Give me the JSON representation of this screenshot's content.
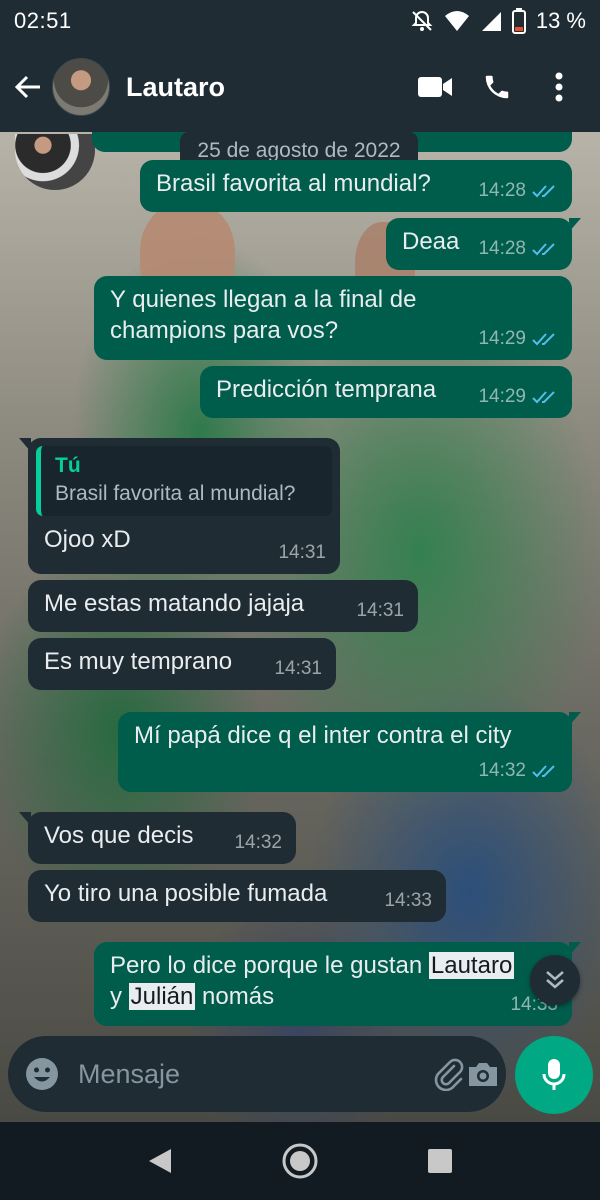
{
  "status_bar": {
    "time": "02:51",
    "battery": "13 %",
    "icons": [
      "notifications-off-icon",
      "wifi-icon",
      "signal-icon",
      "battery-low-icon"
    ]
  },
  "header": {
    "contact_name": "Lautaro",
    "icons": [
      "back-arrow-icon",
      "video-call-icon",
      "voice-call-icon",
      "more-vert-icon"
    ]
  },
  "chat": {
    "date_chip": "25 de agosto de 2022",
    "messages": [
      {
        "direction": "out",
        "text": "Brasil favorita al mundial?",
        "time": "14:28",
        "status": "read"
      },
      {
        "direction": "out",
        "text": "Deaa",
        "time": "14:28",
        "status": "read"
      },
      {
        "direction": "out",
        "text_lines": [
          "Y quienes llegan a la final de",
          "champions para vos?"
        ],
        "time": "14:29",
        "status": "read"
      },
      {
        "direction": "out",
        "text": "Predicción temprana",
        "time": "14:29",
        "status": "read"
      },
      {
        "direction": "in",
        "quote": {
          "author": "Tú",
          "text": "Brasil favorita al mundial?"
        },
        "text": "Ojoo xD",
        "time": "14:31"
      },
      {
        "direction": "in",
        "text": "Me estas matando jajaja",
        "time": "14:31"
      },
      {
        "direction": "in",
        "text": "Es muy temprano",
        "time": "14:31"
      },
      {
        "direction": "out",
        "text": "Mí papá dice q el inter contra el city",
        "time": "14:32",
        "status": "read"
      },
      {
        "direction": "in",
        "text": "Vos que decis",
        "time": "14:32"
      },
      {
        "direction": "in",
        "text": "Yo tiro una posible fumada",
        "time": "14:33"
      },
      {
        "direction": "out",
        "parts": [
          "Pero lo dice porque le gustan ",
          "Lautaro",
          "y ",
          "Julián",
          " nomás"
        ],
        "time": "14:33"
      }
    ]
  },
  "composer": {
    "placeholder": "Mensaje",
    "icons": [
      "emoji-icon",
      "attach-icon",
      "camera-icon",
      "mic-icon"
    ]
  },
  "nav_bar": {
    "icons": [
      "back-triangle-icon",
      "home-circle-icon",
      "recents-square-icon"
    ]
  },
  "colors": {
    "header_bg": "#1f2c34",
    "outgoing_bubble": "#005c4b",
    "incoming_bubble": "#1f2c34",
    "accent": "#00a884",
    "read_ticks": "#53bdeb"
  }
}
